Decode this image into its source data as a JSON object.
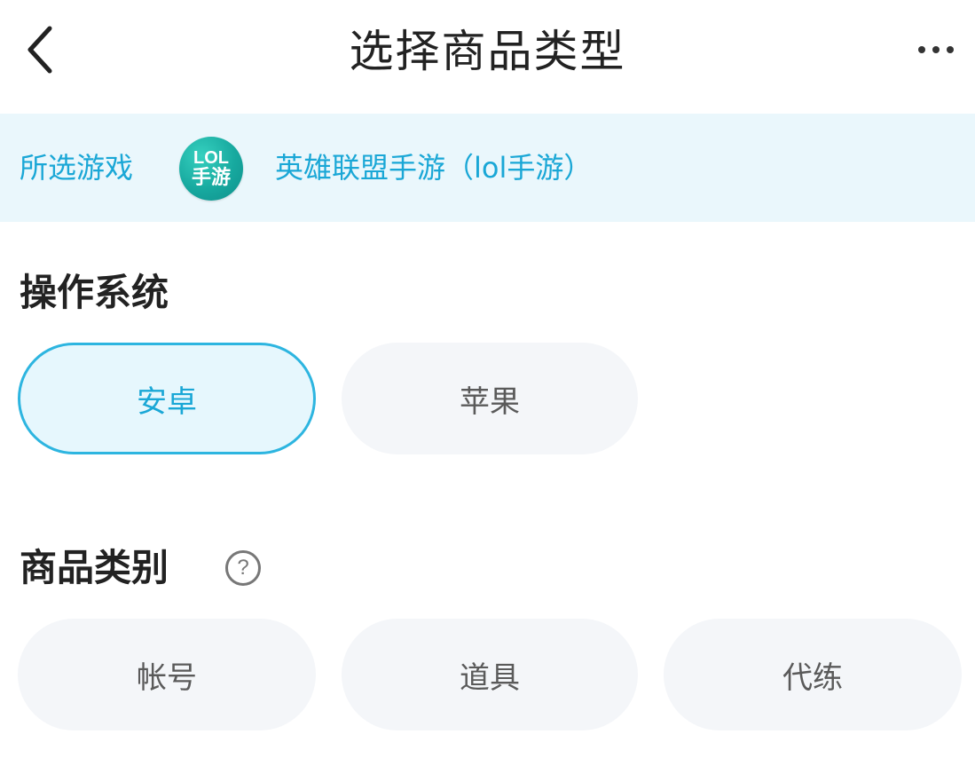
{
  "header": {
    "title": "选择商品类型",
    "back_icon": "chevron-left-icon",
    "more_icon": "more-horizontal-icon"
  },
  "selected_game": {
    "label": "所选游戏",
    "logo_line1": "LOL",
    "logo_line2": "手游",
    "name": "英雄联盟手游（lol手游）"
  },
  "os_section": {
    "title": "操作系统",
    "options": [
      {
        "label": "安卓",
        "selected": true
      },
      {
        "label": "苹果",
        "selected": false
      }
    ]
  },
  "category_section": {
    "title": "商品类别",
    "help_symbol": "?",
    "options": [
      {
        "label": "帐号",
        "selected": false
      },
      {
        "label": "道具",
        "selected": false
      },
      {
        "label": "代练",
        "selected": false
      }
    ]
  },
  "colors": {
    "accent": "#1aa7d6",
    "selected_border": "#2db5e0",
    "selected_bg": "#e6f7fd",
    "chip_bg": "#f4f6f9",
    "game_bar_bg": "#eaf7fc"
  }
}
